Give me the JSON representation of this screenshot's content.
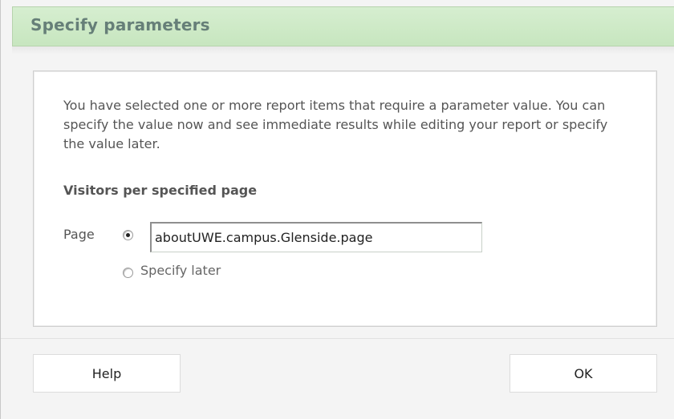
{
  "dialog": {
    "title": "Specify parameters"
  },
  "content": {
    "description": "You have selected one or more report items that require a parameter value. You can specify the value now and see immediate results while editing your report or specify the value later.",
    "section_heading": "Visitors per specified page",
    "parameter": {
      "label": "Page",
      "value": "aboutUWE.campus.Glenside.page",
      "selected_option": "value",
      "specify_later_label": "Specify later"
    }
  },
  "buttons": {
    "help_label": "Help",
    "ok_label": "OK"
  },
  "colors": {
    "title_bar": "#cbe8c3",
    "title_text": "#667f78",
    "background": "#f4f4f4",
    "content_bg": "#ffffff"
  }
}
